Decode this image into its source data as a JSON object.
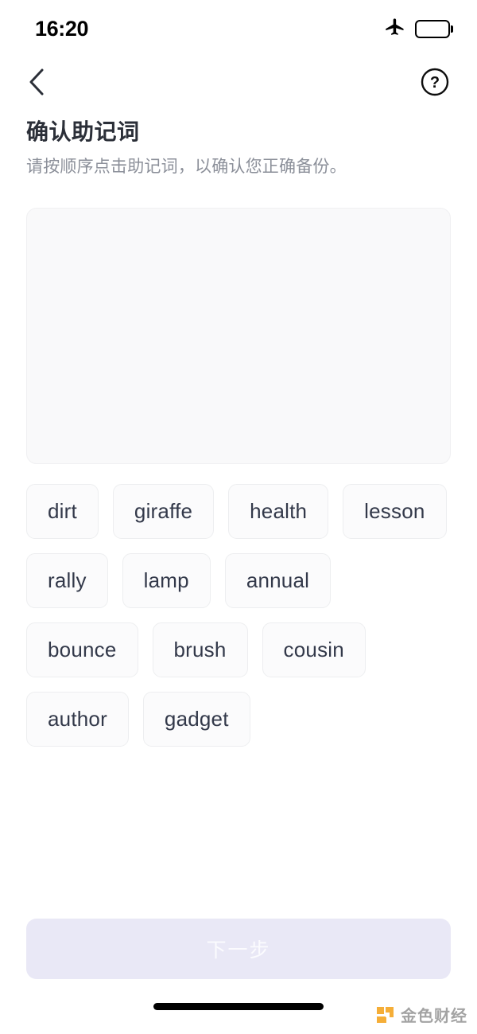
{
  "status_bar": {
    "time": "16:20",
    "airplane_icon": "airplane-icon",
    "battery_icon": "battery-icon",
    "battery_fill_percent": 40,
    "battery_color": "#f7c325"
  },
  "nav": {
    "back_icon": "chevron-left-icon",
    "help_icon": "question-mark-circle-icon"
  },
  "header": {
    "title": "确认助记词",
    "subtitle": "请按顺序点击助记词，以确认您正确备份。"
  },
  "answer_area": {
    "selected_words": [],
    "background_color": "#f9f9fa"
  },
  "word_bank": {
    "words": [
      "dirt",
      "giraffe",
      "health",
      "lesson",
      "rally",
      "lamp",
      "annual",
      "bounce",
      "brush",
      "cousin",
      "author",
      "gadget"
    ]
  },
  "footer": {
    "next_label": "下一步",
    "next_disabled": true,
    "next_background_color": "#e9e8f6",
    "next_text_color": "#fbfbfe"
  },
  "watermark": {
    "text": "金色财经",
    "logo_color": "#f5a623"
  }
}
